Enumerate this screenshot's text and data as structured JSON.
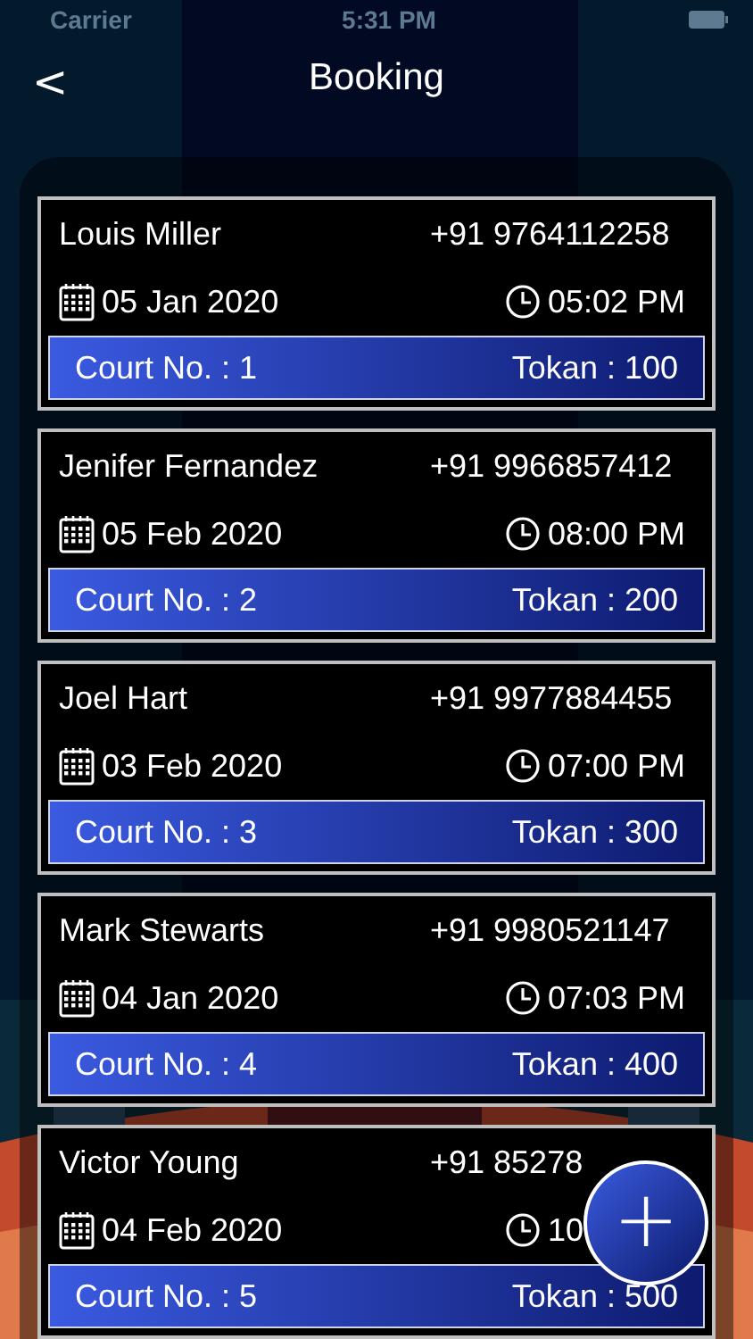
{
  "status_bar": {
    "carrier": "Carrier",
    "time": "5:31 PM"
  },
  "nav": {
    "back": "<",
    "title": "Booking"
  },
  "bookings": [
    {
      "name": "Louis Miller",
      "phone": "+91 9764112258",
      "date": "05 Jan 2020",
      "time": "05:02 PM",
      "court": "Court No. : 1",
      "token": "Tokan : 100"
    },
    {
      "name": "Jenifer Fernandez",
      "phone": "+91 9966857412",
      "date": "05 Feb 2020",
      "time": "08:00 PM",
      "court": "Court No. : 2",
      "token": "Tokan : 200"
    },
    {
      "name": "Joel Hart",
      "phone": "+91 9977884455",
      "date": "03 Feb 2020",
      "time": "07:00 PM",
      "court": "Court No. : 3",
      "token": "Tokan : 300"
    },
    {
      "name": "Mark Stewarts",
      "phone": "+91 9980521147",
      "date": "04 Jan 2020",
      "time": "07:03 PM",
      "court": "Court No. : 4",
      "token": "Tokan : 400"
    },
    {
      "name": "Victor Young",
      "phone": "+91 85278",
      "date": "04 Feb 2020",
      "time": "10",
      "court": "Court No. : 5",
      "token": "Tokan : 500"
    }
  ],
  "fab": {
    "label": "+"
  }
}
